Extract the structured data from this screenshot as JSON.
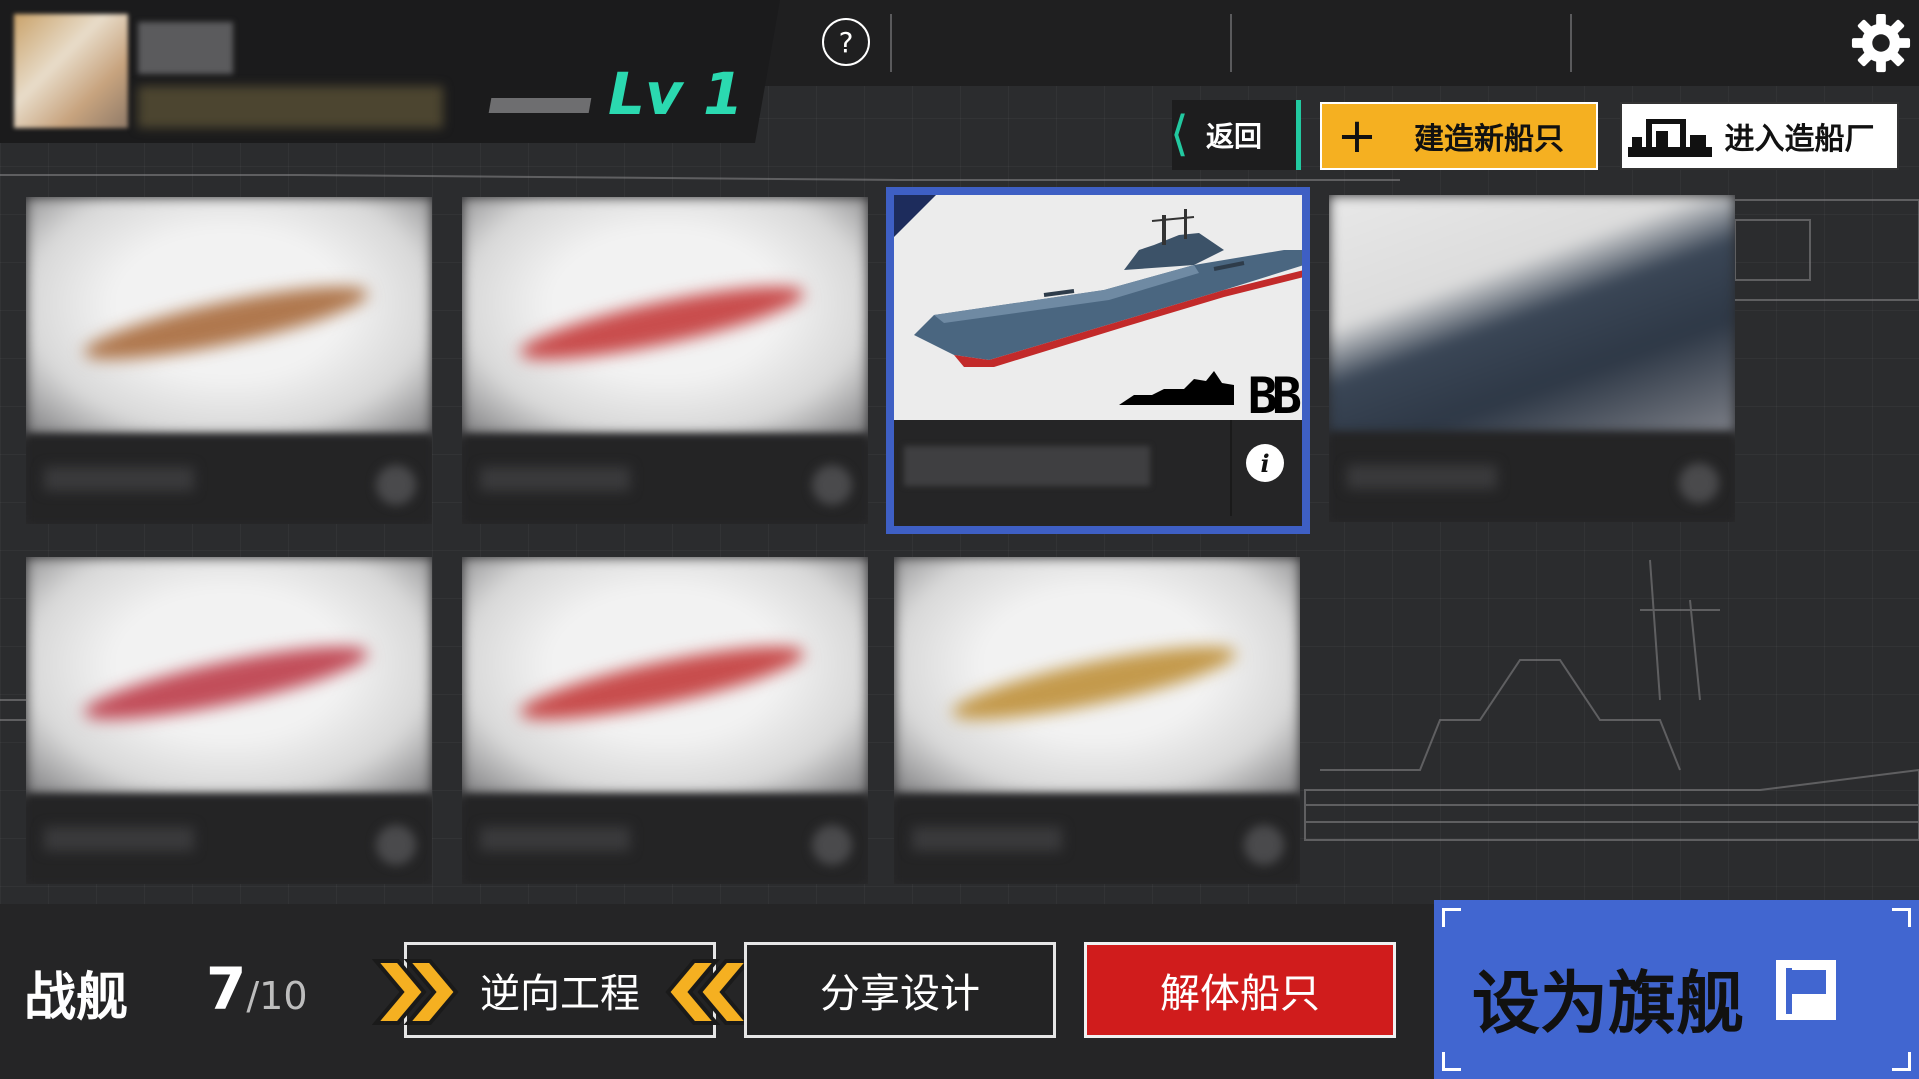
{
  "header": {
    "level_text": "Lv 1",
    "help_symbol": "?",
    "back_label": "返回",
    "new_ship_label": "建造新船只",
    "new_ship_symbol": "+",
    "shipyard_label": "进入造船厂"
  },
  "selected_ship": {
    "class_label": "BB",
    "info_symbol": "i"
  },
  "ships": [
    {
      "streak_color": "#b0784e"
    },
    {
      "streak_color": "#c94d4d"
    },
    {
      "streak_color": "#2c3a4c"
    },
    {
      "streak_color": "#c24e5a"
    },
    {
      "streak_color": "#c84d4d"
    },
    {
      "streak_color": "#c49a4c"
    }
  ],
  "footer": {
    "category_label": "战舰",
    "count": "7",
    "count_total": "/10",
    "reverse_engineering_label": "逆向工程",
    "share_label": "分享设计",
    "scrap_label": "解体船只",
    "set_flagship_label": "设为旗舰"
  },
  "colors": {
    "accent_teal": "#2bd9b0",
    "accent_yellow": "#f5b021",
    "accent_blue": "#4166d0",
    "danger_red": "#d01c1c"
  }
}
